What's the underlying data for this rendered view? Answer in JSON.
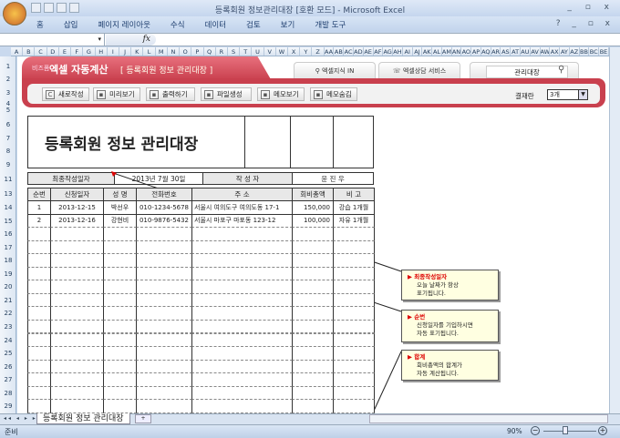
{
  "window": {
    "title": "등록회원 정보관리대장 [호환 모드] - Microsoft Excel",
    "controls": "_ ▫ x"
  },
  "ribbon": {
    "tabs": [
      "홈",
      "삽입",
      "페이지 레이아웃",
      "수식",
      "데이터",
      "검토",
      "보기",
      "개발 도구"
    ],
    "controls": "? _ ▫ x"
  },
  "formula": {
    "fx": "fx",
    "name_arrow": "▾"
  },
  "columns": [
    "A",
    "B",
    "C",
    "D",
    "E",
    "F",
    "G",
    "H",
    "I",
    "J",
    "K",
    "L",
    "M",
    "N",
    "O",
    "P",
    "Q",
    "R",
    "S",
    "T",
    "U",
    "V",
    "W",
    "X",
    "Y",
    "Z",
    "AA",
    "AB",
    "AC",
    "AD",
    "AE",
    "AF",
    "AG",
    "AH",
    "AI",
    "AJ",
    "AK",
    "AL",
    "AM",
    "AN",
    "AO",
    "AP",
    "AQ",
    "AR",
    "AS",
    "AT",
    "AU",
    "AV",
    "AW",
    "AX",
    "AY",
    "AZ",
    "BB",
    "BC",
    "BE"
  ],
  "rows": [
    "1",
    "2",
    "3",
    "4",
    "5",
    "6",
    "7",
    "8",
    "9",
    "11",
    "13",
    "14",
    "15",
    "16",
    "17",
    "18",
    "19",
    "20",
    "21",
    "22",
    "23",
    "24",
    "25",
    "26",
    "27",
    "28",
    "29"
  ],
  "banner": {
    "brand_small": "비즈폼",
    "brand": "엑셀 자동계산",
    "title": "[ 등록회원 정보 관리대장 ]",
    "tabs": [
      "엑셀지식 IN",
      "엑셀상담 서비스"
    ],
    "search_value": "관리대장"
  },
  "toolbar": {
    "buttons": [
      {
        "label": "새로작성",
        "icon": "refresh-icon"
      },
      {
        "label": "미리보기",
        "icon": "monitor-icon"
      },
      {
        "label": "출력하기",
        "icon": "print-icon"
      },
      {
        "label": "파일생성",
        "icon": "folder-icon"
      },
      {
        "label": "메모보기",
        "icon": "memo-icon"
      },
      {
        "label": "메모숨김",
        "icon": "close-box-icon"
      }
    ],
    "approval_label": "결재란",
    "approval_value": "3개"
  },
  "sheet": {
    "title": "등록회원 정보 관리대장",
    "last_date_label": "최종작성일자",
    "last_date": "2013년 7월 30일",
    "author_label": "작 성 자",
    "author": "윤 진 우",
    "headers": [
      "순번",
      "신청일자",
      "성 명",
      "전화번호",
      "주 소",
      "회비총액",
      "비 고"
    ],
    "records": [
      [
        "1",
        "2013-12-15",
        "박선우",
        "010-1234-5678",
        "서울시 여의도구 여의도동 17-1",
        "150,000",
        "강습 1개월"
      ],
      [
        "2",
        "2013-12-16",
        "강현비",
        "010-9876-5432",
        "서울시 마포구 마포동 123-12",
        "100,000",
        "자유 1개월"
      ]
    ]
  },
  "callouts": [
    {
      "title": "최종작성일자",
      "body": [
        "오늘 날짜가 항상",
        "표기됩니다."
      ]
    },
    {
      "title": "순번",
      "body": [
        "신청일자를 기입하시면",
        "자동 표기됩니다."
      ]
    },
    {
      "title": "합계",
      "body": [
        "회비총액의 합계가",
        "자동 계산됩니다."
      ]
    }
  ],
  "sheet_tabs": {
    "active": "등록회원 정보 관리대장"
  },
  "status": {
    "ready": "준비",
    "zoom": "90%"
  }
}
